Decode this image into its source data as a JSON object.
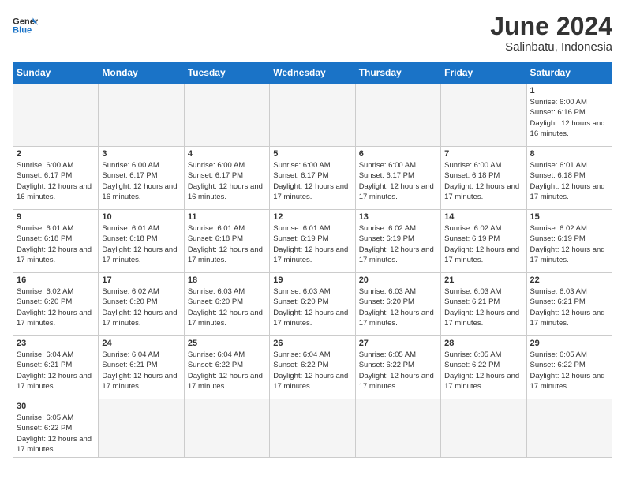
{
  "header": {
    "logo_general": "General",
    "logo_blue": "Blue",
    "title": "June 2024",
    "subtitle": "Salinbatu, Indonesia"
  },
  "weekdays": [
    "Sunday",
    "Monday",
    "Tuesday",
    "Wednesday",
    "Thursday",
    "Friday",
    "Saturday"
  ],
  "weeks": [
    {
      "days": [
        {
          "num": "",
          "info": ""
        },
        {
          "num": "",
          "info": ""
        },
        {
          "num": "",
          "info": ""
        },
        {
          "num": "",
          "info": ""
        },
        {
          "num": "",
          "info": ""
        },
        {
          "num": "",
          "info": ""
        },
        {
          "num": "1",
          "info": "Sunrise: 6:00 AM\nSunset: 6:16 PM\nDaylight: 12 hours\nand 16 minutes."
        }
      ]
    },
    {
      "days": [
        {
          "num": "2",
          "info": "Sunrise: 6:00 AM\nSunset: 6:17 PM\nDaylight: 12 hours\nand 16 minutes."
        },
        {
          "num": "3",
          "info": "Sunrise: 6:00 AM\nSunset: 6:17 PM\nDaylight: 12 hours\nand 16 minutes."
        },
        {
          "num": "4",
          "info": "Sunrise: 6:00 AM\nSunset: 6:17 PM\nDaylight: 12 hours\nand 16 minutes."
        },
        {
          "num": "5",
          "info": "Sunrise: 6:00 AM\nSunset: 6:17 PM\nDaylight: 12 hours\nand 17 minutes."
        },
        {
          "num": "6",
          "info": "Sunrise: 6:00 AM\nSunset: 6:17 PM\nDaylight: 12 hours\nand 17 minutes."
        },
        {
          "num": "7",
          "info": "Sunrise: 6:00 AM\nSunset: 6:18 PM\nDaylight: 12 hours\nand 17 minutes."
        },
        {
          "num": "8",
          "info": "Sunrise: 6:01 AM\nSunset: 6:18 PM\nDaylight: 12 hours\nand 17 minutes."
        }
      ]
    },
    {
      "days": [
        {
          "num": "9",
          "info": "Sunrise: 6:01 AM\nSunset: 6:18 PM\nDaylight: 12 hours\nand 17 minutes."
        },
        {
          "num": "10",
          "info": "Sunrise: 6:01 AM\nSunset: 6:18 PM\nDaylight: 12 hours\nand 17 minutes."
        },
        {
          "num": "11",
          "info": "Sunrise: 6:01 AM\nSunset: 6:18 PM\nDaylight: 12 hours\nand 17 minutes."
        },
        {
          "num": "12",
          "info": "Sunrise: 6:01 AM\nSunset: 6:19 PM\nDaylight: 12 hours\nand 17 minutes."
        },
        {
          "num": "13",
          "info": "Sunrise: 6:02 AM\nSunset: 6:19 PM\nDaylight: 12 hours\nand 17 minutes."
        },
        {
          "num": "14",
          "info": "Sunrise: 6:02 AM\nSunset: 6:19 PM\nDaylight: 12 hours\nand 17 minutes."
        },
        {
          "num": "15",
          "info": "Sunrise: 6:02 AM\nSunset: 6:19 PM\nDaylight: 12 hours\nand 17 minutes."
        }
      ]
    },
    {
      "days": [
        {
          "num": "16",
          "info": "Sunrise: 6:02 AM\nSunset: 6:20 PM\nDaylight: 12 hours\nand 17 minutes."
        },
        {
          "num": "17",
          "info": "Sunrise: 6:02 AM\nSunset: 6:20 PM\nDaylight: 12 hours\nand 17 minutes."
        },
        {
          "num": "18",
          "info": "Sunrise: 6:03 AM\nSunset: 6:20 PM\nDaylight: 12 hours\nand 17 minutes."
        },
        {
          "num": "19",
          "info": "Sunrise: 6:03 AM\nSunset: 6:20 PM\nDaylight: 12 hours\nand 17 minutes."
        },
        {
          "num": "20",
          "info": "Sunrise: 6:03 AM\nSunset: 6:20 PM\nDaylight: 12 hours\nand 17 minutes."
        },
        {
          "num": "21",
          "info": "Sunrise: 6:03 AM\nSunset: 6:21 PM\nDaylight: 12 hours\nand 17 minutes."
        },
        {
          "num": "22",
          "info": "Sunrise: 6:03 AM\nSunset: 6:21 PM\nDaylight: 12 hours\nand 17 minutes."
        }
      ]
    },
    {
      "days": [
        {
          "num": "23",
          "info": "Sunrise: 6:04 AM\nSunset: 6:21 PM\nDaylight: 12 hours\nand 17 minutes."
        },
        {
          "num": "24",
          "info": "Sunrise: 6:04 AM\nSunset: 6:21 PM\nDaylight: 12 hours\nand 17 minutes."
        },
        {
          "num": "25",
          "info": "Sunrise: 6:04 AM\nSunset: 6:22 PM\nDaylight: 12 hours\nand 17 minutes."
        },
        {
          "num": "26",
          "info": "Sunrise: 6:04 AM\nSunset: 6:22 PM\nDaylight: 12 hours\nand 17 minutes."
        },
        {
          "num": "27",
          "info": "Sunrise: 6:05 AM\nSunset: 6:22 PM\nDaylight: 12 hours\nand 17 minutes."
        },
        {
          "num": "28",
          "info": "Sunrise: 6:05 AM\nSunset: 6:22 PM\nDaylight: 12 hours\nand 17 minutes."
        },
        {
          "num": "29",
          "info": "Sunrise: 6:05 AM\nSunset: 6:22 PM\nDaylight: 12 hours\nand 17 minutes."
        }
      ]
    },
    {
      "days": [
        {
          "num": "30",
          "info": "Sunrise: 6:05 AM\nSunset: 6:22 PM\nDaylight: 12 hours\nand 17 minutes."
        },
        {
          "num": "",
          "info": ""
        },
        {
          "num": "",
          "info": ""
        },
        {
          "num": "",
          "info": ""
        },
        {
          "num": "",
          "info": ""
        },
        {
          "num": "",
          "info": ""
        },
        {
          "num": "",
          "info": ""
        }
      ]
    }
  ]
}
